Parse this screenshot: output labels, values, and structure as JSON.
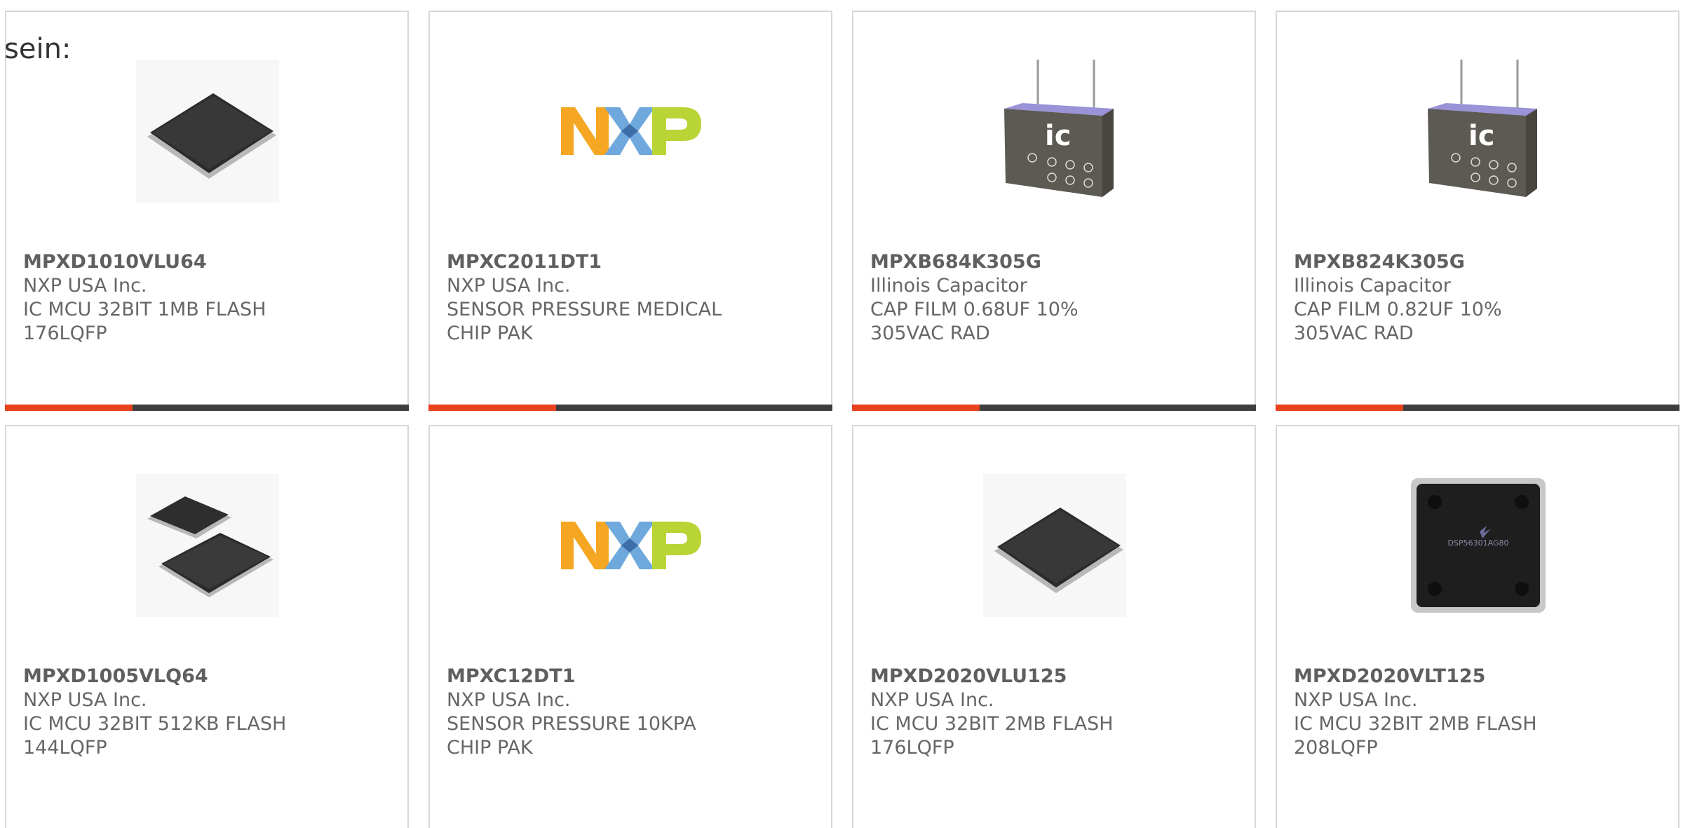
{
  "heading": "sein:",
  "colors": {
    "accent": "#e8411d",
    "bar": "#3d3d3d",
    "border": "#d8d8d8",
    "text": "#666666"
  },
  "products": [
    {
      "part": "MPXD1010VLU64",
      "manufacturer": "NXP USA Inc.",
      "description": "IC MCU 32BIT 1MB FLASH 176LQFP",
      "image": "qfp-chip-icon"
    },
    {
      "part": "MPXC2011DT1",
      "manufacturer": "NXP USA Inc.",
      "description": "SENSOR PRESSURE MEDICAL CHIP PAK",
      "image": "nxp-logo-icon"
    },
    {
      "part": "MPXB684K305G",
      "manufacturer": "Illinois Capacitor",
      "description": "CAP FILM 0.68UF 10% 305VAC RAD",
      "image": "film-capacitor-icon"
    },
    {
      "part": "MPXB824K305G",
      "manufacturer": "Illinois Capacitor",
      "description": "CAP FILM 0.82UF 10% 305VAC RAD",
      "image": "film-capacitor-icon"
    },
    {
      "part": "MPXD1005VLQ64",
      "manufacturer": "NXP USA Inc.",
      "description": "IC MCU 32BIT 512KB FLASH 144LQFP",
      "image": "two-qfp-chips-icon"
    },
    {
      "part": "MPXC12DT1",
      "manufacturer": "NXP USA Inc.",
      "description": "SENSOR PRESSURE 10KPA CHIP PAK",
      "image": "nxp-logo-icon"
    },
    {
      "part": "MPXD2020VLU125",
      "manufacturer": "NXP USA Inc.",
      "description": "IC MCU 32BIT 2MB FLASH 176LQFP",
      "image": "qfp-chip-icon"
    },
    {
      "part": "MPXD2020VLT125",
      "manufacturer": "NXP USA Inc.",
      "description": "IC MCU 32BIT 2MB FLASH 208LQFP",
      "image": "chip-topview-icon",
      "chip_marking": "DSP56301AG80"
    }
  ]
}
